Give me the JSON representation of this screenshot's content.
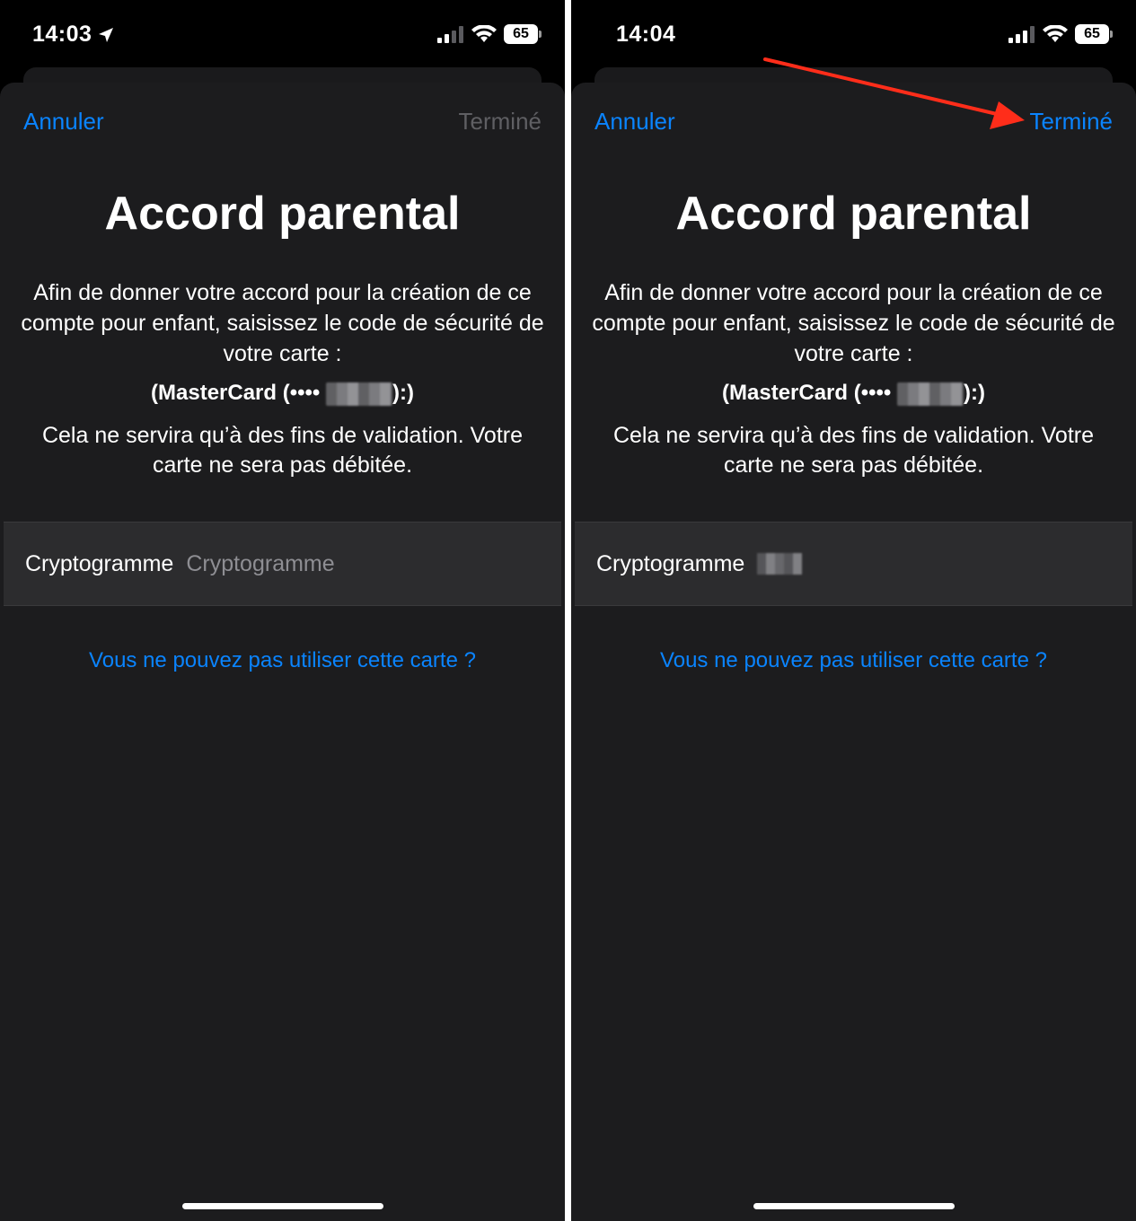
{
  "screens": [
    {
      "time": "14:03",
      "battery": "65",
      "cancel_label": "Annuler",
      "done_label": "Terminé",
      "title": "Accord parental",
      "description": "Afin de donner votre accord pour la création de ce compte pour enfant, saisissez le code de sécurité de votre carte :",
      "card_prefix": "(MasterCard (••••",
      "card_suffix": "):)",
      "note": "Cela ne servira qu’à des fins de validation. Votre carte ne sera pas débitée.",
      "field_label": "Cryptogramme",
      "field_placeholder": "Cryptogramme",
      "link": "Vous ne pouvez pas utiliser cette carte ?"
    },
    {
      "time": "14:04",
      "battery": "65",
      "cancel_label": "Annuler",
      "done_label": "Terminé",
      "title": "Accord parental",
      "description": "Afin de donner votre accord pour la création de ce compte pour enfant, saisissez le code de sécurité de votre carte :",
      "card_prefix": "(MasterCard (••••",
      "card_suffix": "):)",
      "note": "Cela ne servira qu’à des fins de validation. Votre carte ne sera pas débitée.",
      "field_label": "Cryptogramme",
      "link": "Vous ne pouvez pas utiliser cette carte ?"
    }
  ],
  "colors": {
    "accent": "#0a84ff",
    "disabled": "#5f5f63",
    "sheet": "#1c1c1e",
    "field": "#2c2c2e",
    "annotation_arrow": "#ff2d1a"
  },
  "icons": [
    "location-arrow-icon",
    "signal-icon",
    "wifi-icon",
    "battery-icon"
  ]
}
